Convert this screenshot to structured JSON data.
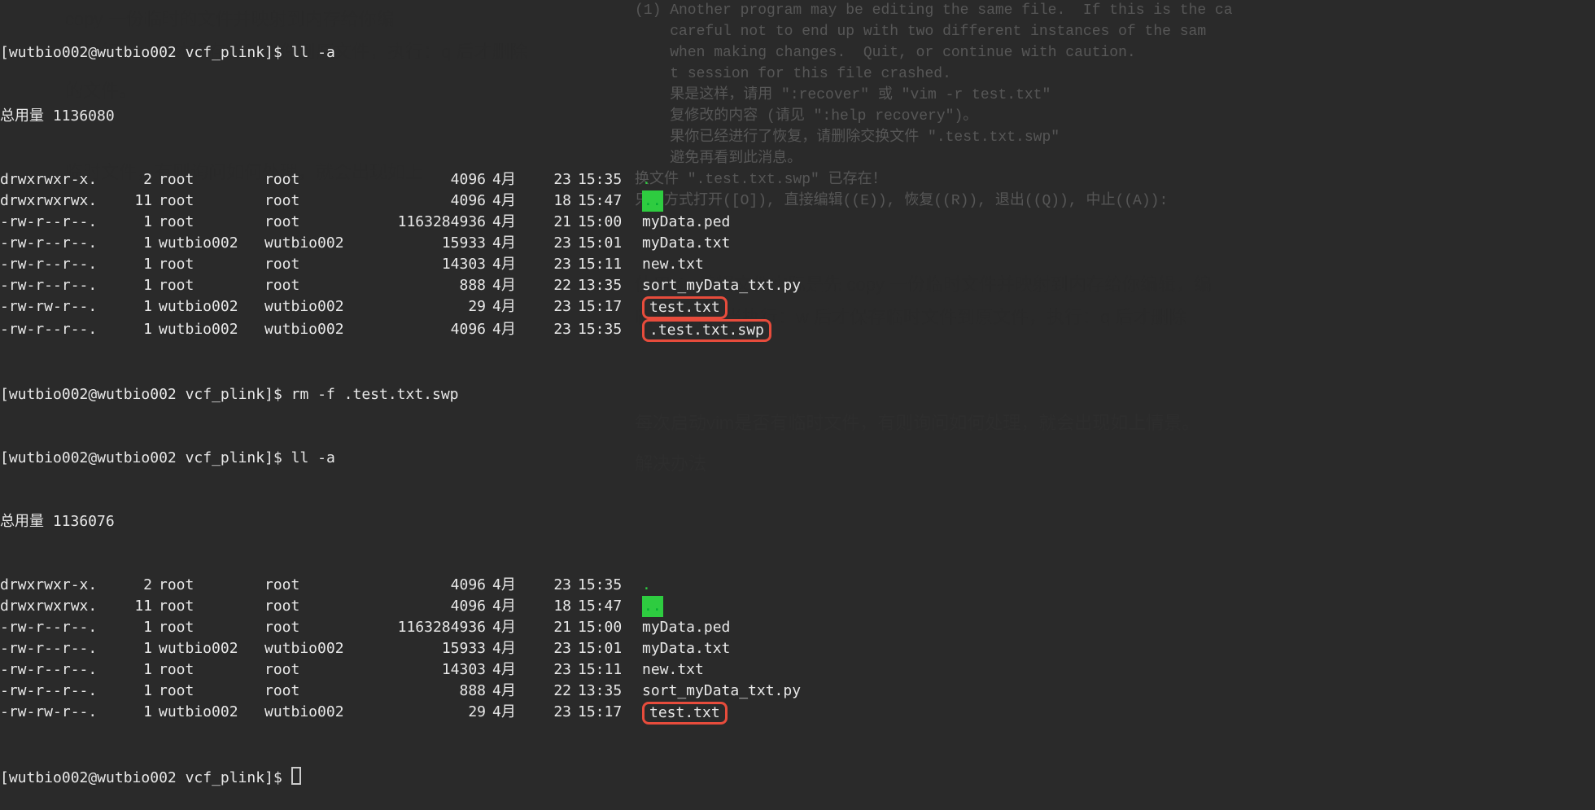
{
  "prompt1": "[wutbio002@wutbio002 vcf_plink]$ ll -a",
  "total1": "总用量 1136080",
  "listing1": [
    {
      "perm": "drwxrwxr-x.",
      "links": "2",
      "owner": "root",
      "group": "root",
      "size": "4096",
      "month": "4月",
      "day": "23",
      "time": "15:35",
      "name": ".",
      "green": true
    },
    {
      "perm": "drwxrwxrwx.",
      "links": "11",
      "owner": "root",
      "group": "root",
      "size": "4096",
      "month": "4月",
      "day": "18",
      "time": "15:47",
      "name": "..",
      "greenbg": true
    },
    {
      "perm": "-rw-r--r--.",
      "links": "1",
      "owner": "root",
      "group": "root",
      "size": "1163284936",
      "month": "4月",
      "day": "21",
      "time": "15:00",
      "name": "myData.ped"
    },
    {
      "perm": "-rw-r--r--.",
      "links": "1",
      "owner": "wutbio002",
      "group": "wutbio002",
      "size": "15933",
      "month": "4月",
      "day": "23",
      "time": "15:01",
      "name": "myData.txt"
    },
    {
      "perm": "-rw-r--r--.",
      "links": "1",
      "owner": "root",
      "group": "root",
      "size": "14303",
      "month": "4月",
      "day": "23",
      "time": "15:11",
      "name": "new.txt"
    },
    {
      "perm": "-rw-r--r--.",
      "links": "1",
      "owner": "root",
      "group": "root",
      "size": "888",
      "month": "4月",
      "day": "22",
      "time": "13:35",
      "name": "sort_myData_txt.py"
    },
    {
      "perm": "-rw-rw-r--.",
      "links": "1",
      "owner": "wutbio002",
      "group": "wutbio002",
      "size": "29",
      "month": "4月",
      "day": "23",
      "time": "15:17",
      "name": "test.txt",
      "hl": true
    },
    {
      "perm": "-rw-r--r--.",
      "links": "1",
      "owner": "wutbio002",
      "group": "wutbio002",
      "size": "4096",
      "month": "4月",
      "day": "23",
      "time": "15:35",
      "name": ".test.txt.swp",
      "hl": true
    }
  ],
  "prompt2": "[wutbio002@wutbio002 vcf_plink]$ rm -f .test.txt.swp",
  "prompt3": "[wutbio002@wutbio002 vcf_plink]$ ll -a",
  "total2": "总用量 1136076",
  "listing2": [
    {
      "perm": "drwxrwxr-x.",
      "links": "2",
      "owner": "root",
      "group": "root",
      "size": "4096",
      "month": "4月",
      "day": "23",
      "time": "15:35",
      "name": ".",
      "green": true
    },
    {
      "perm": "drwxrwxrwx.",
      "links": "11",
      "owner": "root",
      "group": "root",
      "size": "4096",
      "month": "4月",
      "day": "18",
      "time": "15:47",
      "name": "..",
      "greenbg": true
    },
    {
      "perm": "-rw-r--r--.",
      "links": "1",
      "owner": "root",
      "group": "root",
      "size": "1163284936",
      "month": "4月",
      "day": "21",
      "time": "15:00",
      "name": "myData.ped"
    },
    {
      "perm": "-rw-r--r--.",
      "links": "1",
      "owner": "wutbio002",
      "group": "wutbio002",
      "size": "15933",
      "month": "4月",
      "day": "23",
      "time": "15:01",
      "name": "myData.txt"
    },
    {
      "perm": "-rw-r--r--.",
      "links": "1",
      "owner": "root",
      "group": "root",
      "size": "14303",
      "month": "4月",
      "day": "23",
      "time": "15:11",
      "name": "new.txt"
    },
    {
      "perm": "-rw-r--r--.",
      "links": "1",
      "owner": "root",
      "group": "root",
      "size": "888",
      "month": "4月",
      "day": "22",
      "time": "13:35",
      "name": "sort_myData_txt.py"
    },
    {
      "perm": "-rw-rw-r--.",
      "links": "1",
      "owner": "wutbio002",
      "group": "wutbio002",
      "size": "29",
      "month": "4月",
      "day": "23",
      "time": "15:17",
      "name": "test.txt",
      "hl": true
    }
  ],
  "prompt4": "[wutbio002@wutbio002 vcf_plink]$ ",
  "vim_msg": [
    "(1) Another program may be editing the same file.  If this is the ca",
    "    careful not to end up with two different instances of the sam",
    "    when making changes.  Quit, or continue with caution.",
    "    t session for this file crashed.",
    "    果是这样，请用 \":recover\" 或 \"vim -r test.txt\"",
    "    复修改的内容 (请见 \":help recovery\")。",
    "    果你已经进行了恢复，请删除交换文件 \".test.txt.swp\"",
    "    避免再看到此消息。",
    "",
    "换文件 \".test.txt.swp\" 已存在！",
    "只读方式打开([O]), 直接编辑((E)), 恢复((R)), 退出((Q)), 中止((A)):"
  ],
  "article1": "使用vim编辑文件实际是先 copy 一份临时文件并映射到内存给你编辑，编",
  "article2": "临时文件，当执行：w 后才保存临时文件到原文件，执行：q 后才删除",
  "article3": "每次启动vim是否有临时文件，有则询问如何处理，就会出现如上情景。",
  "article4": "解决办法",
  "behind1": "copy 一份临时的文件并映射到内存给你编",
  "behind2": "当执行：w 后才保存临时文件到原文件，执行：q 后才删除",
  "behind3": "的文件。",
  "behind4": "临时文件，有则询问如何处理，就会出现如上"
}
